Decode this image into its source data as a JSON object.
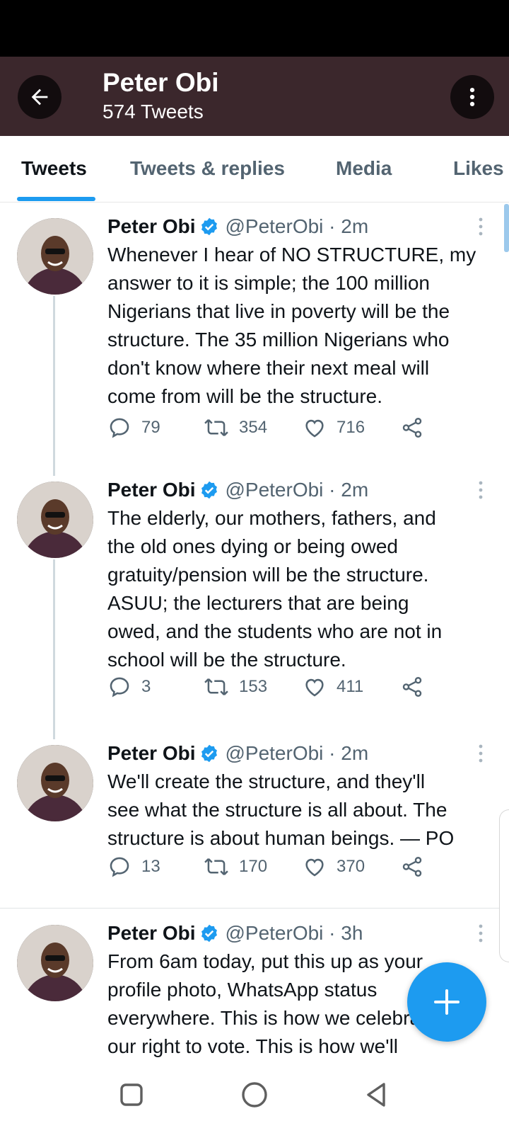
{
  "header": {
    "title": "Peter Obi",
    "subtitle": "574 Tweets",
    "back_icon": "arrow-left-icon",
    "more_icon": "more-vertical-icon",
    "background": "#3b272c"
  },
  "tabs": [
    {
      "label": "Tweets",
      "active": true
    },
    {
      "label": "Tweets & replies",
      "active": false
    },
    {
      "label": "Media",
      "active": false
    },
    {
      "label": "Likes",
      "active": false
    }
  ],
  "accent_color": "#1d9bf0",
  "tweets": [
    {
      "name": "Peter Obi",
      "handle": "@PeterObi · 2m",
      "text": "Whenever I hear of NO STRUCTURE, my\nanswer to it is simple; the 100 million\nNigerians that live in poverty will be the\nstructure. The 35 million Nigerians who\ndon't know where their next meal will\ncome from will be the structure.",
      "replies": "79",
      "retweets": "354",
      "likes": "716"
    },
    {
      "name": "Peter Obi",
      "handle": "@PeterObi · 2m",
      "text": "The elderly, our mothers, fathers, and\nthe old ones dying or being owed\ngratuity/pension will be the structure.\nASUU; the lecturers that are being\nowed, and the students who are not in\nschool will be the structure.",
      "replies": "3",
      "retweets": "153",
      "likes": "411"
    },
    {
      "name": "Peter Obi",
      "handle": "@PeterObi · 2m",
      "text": "We'll create the structure, and they'll\nsee what the structure is all about. The\nstructure is about human beings. — PO",
      "replies": "13",
      "retweets": "170",
      "likes": "370"
    },
    {
      "name": "Peter Obi",
      "handle": "@PeterObi · 3h",
      "text": "From 6am today, put this up as your\nprofile photo, WhatsApp status\neverywhere. This is how we celebrate\nour right to vote. This is how we'll"
    }
  ],
  "fab": {
    "icon": "plus-icon"
  },
  "nav": {
    "recents_icon": "square-icon",
    "home_icon": "circle-icon",
    "back_icon": "triangle-back-icon"
  }
}
